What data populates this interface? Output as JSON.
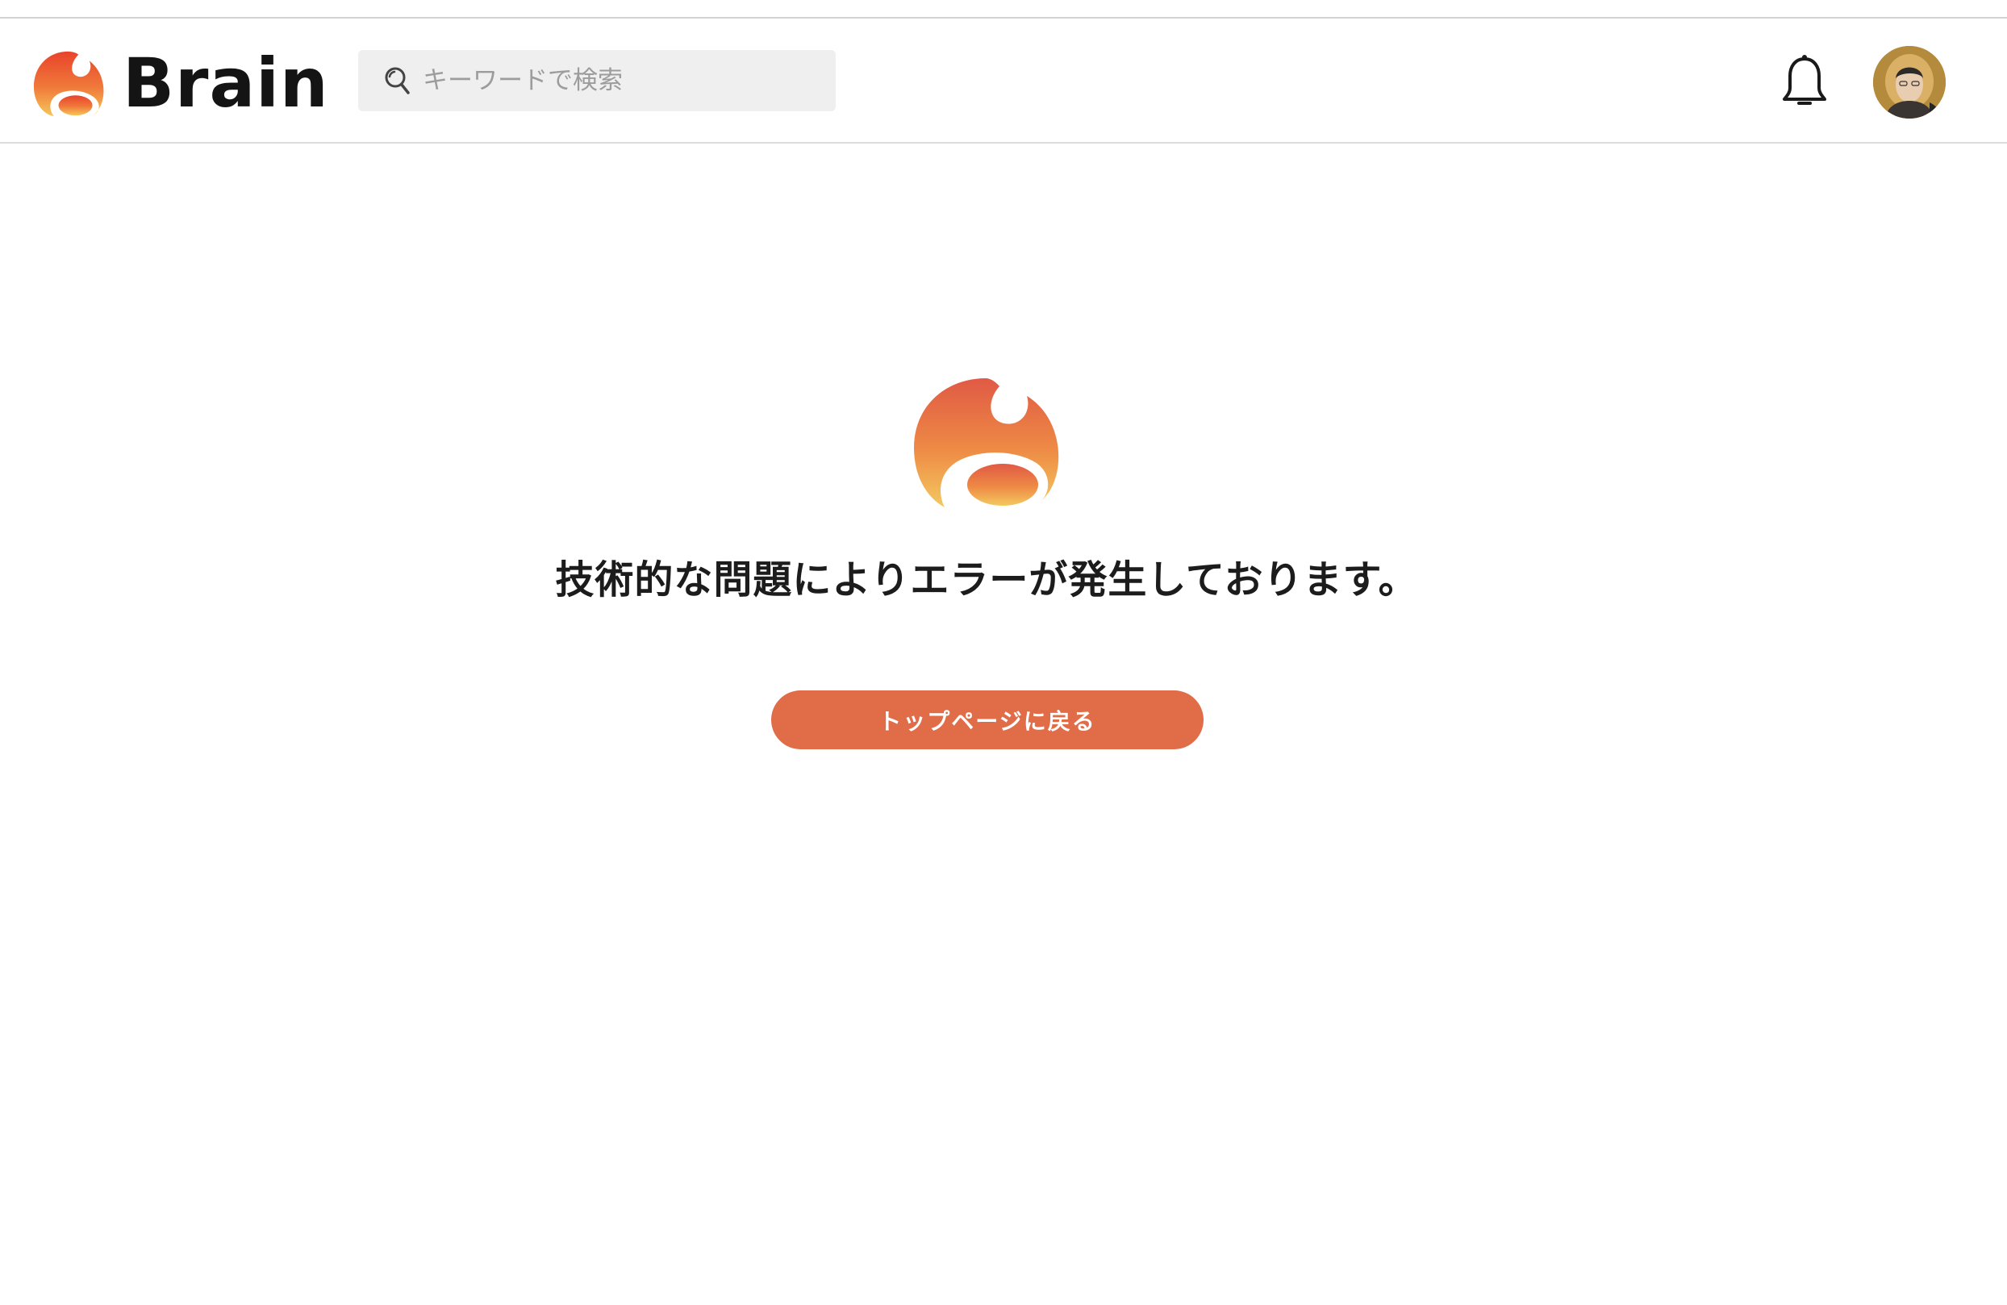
{
  "header": {
    "brand_name": "Brain",
    "search": {
      "placeholder": "キーワードで検索",
      "value": ""
    },
    "icons": {
      "notifications": "bell-icon",
      "search": "search-icon"
    }
  },
  "error_page": {
    "message": "技術的な問題によりエラーが発生しております。",
    "back_button_label": "トップページに戻る"
  },
  "colors": {
    "brand_red": "#e8432b",
    "brand_orange": "#f08c3c",
    "brand_yellow": "#f5c75a",
    "button": "#e06c48",
    "header_border": "#dcdcdc"
  }
}
